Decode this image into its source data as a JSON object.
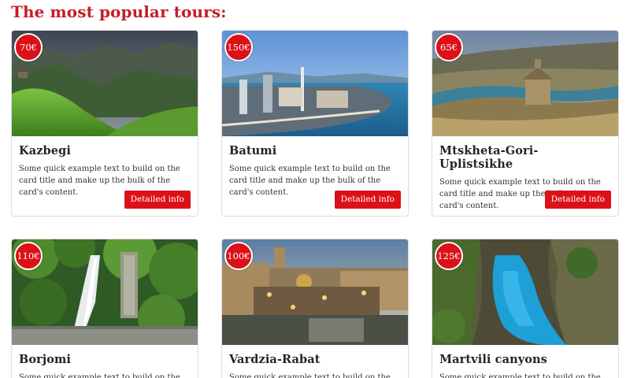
{
  "page": {
    "heading": "The most popular tours:"
  },
  "tours": [
    {
      "name": "Kazbegi",
      "price": "70€",
      "text": "Some quick example text to build on the card title and make up the bulk of the card's content.",
      "button": "Detailed info"
    },
    {
      "name": "Batumi",
      "price": "150€",
      "text": "Some quick example text to build on the card title and make up the bulk of the card's content.",
      "button": "Detailed info"
    },
    {
      "name": "Mtskheta-Gori-Uplistsikhe",
      "price": "65€",
      "text": "Some quick example text to build on the card title and make up the bulk of the card's content.",
      "button": "Detailed info"
    },
    {
      "name": "Borjomi",
      "price": "110€",
      "text": "Some quick example text to build on the card title"
    },
    {
      "name": "Vardzia-Rabat",
      "price": "100€",
      "text": "Some quick example text to build on the card title"
    },
    {
      "name": "Martvili canyons",
      "price": "125€",
      "text": "Some quick example text to build on the card title"
    }
  ],
  "colors": {
    "accent": "#dc1118",
    "heading": "#c41e25"
  }
}
